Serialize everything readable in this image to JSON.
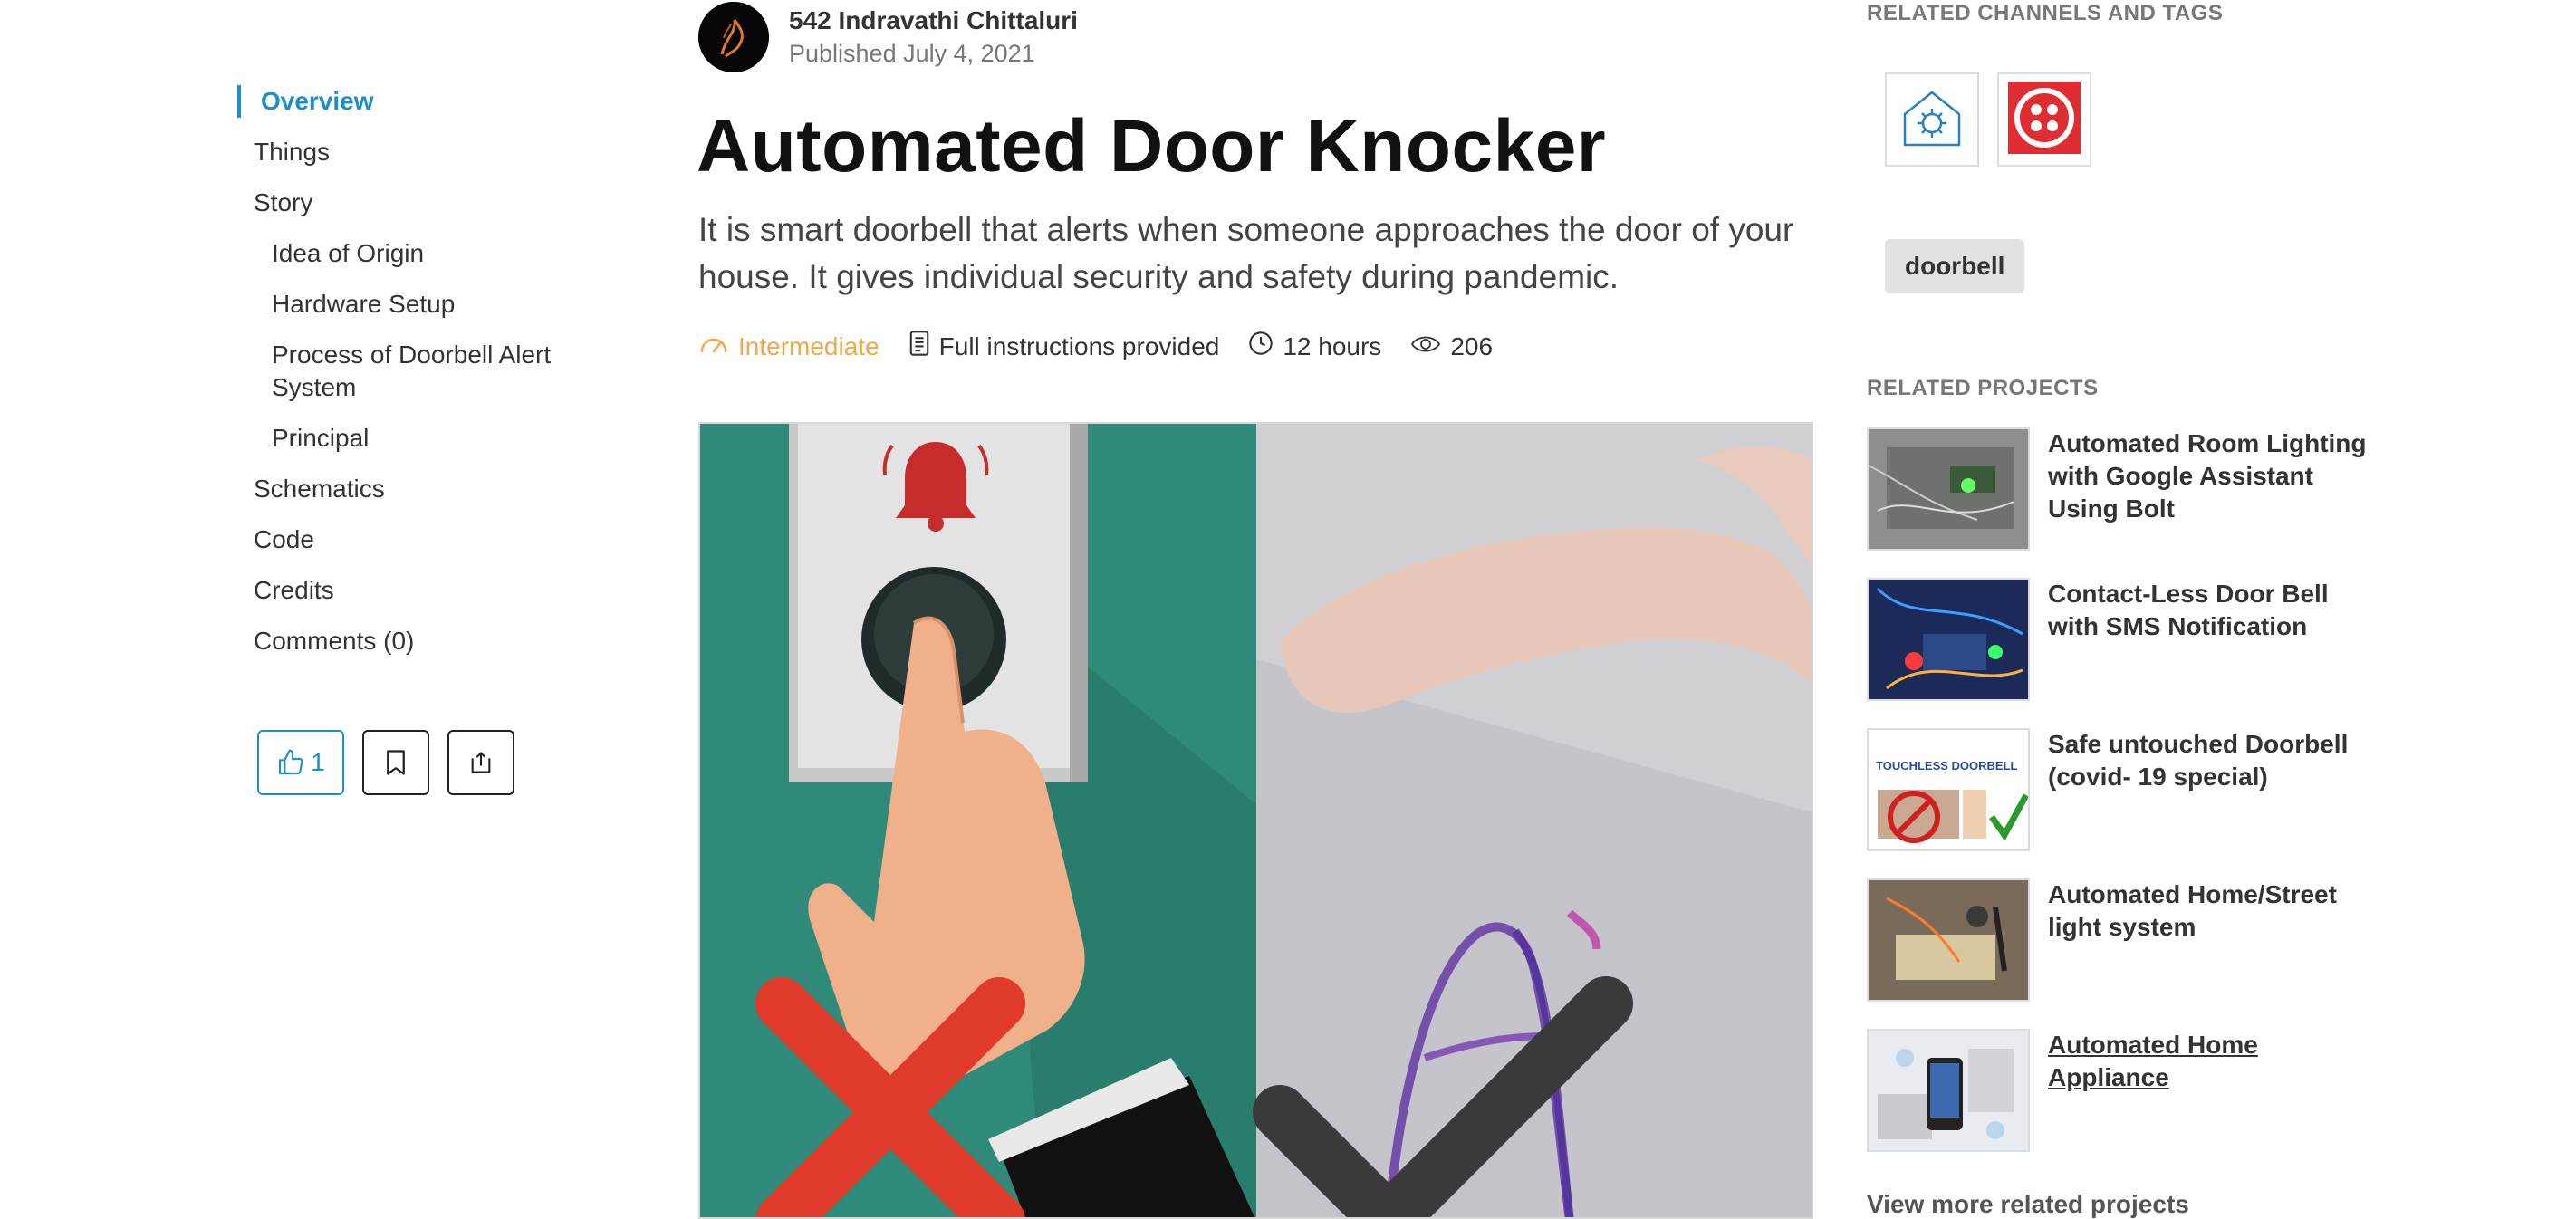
{
  "toc": {
    "items": [
      {
        "label": "Overview"
      },
      {
        "label": "Things"
      },
      {
        "label": "Story"
      },
      {
        "label": "Idea of Origin"
      },
      {
        "label": "Hardware Setup"
      },
      {
        "label": "Process of Doorbell Alert System"
      },
      {
        "label": "Principal"
      },
      {
        "label": "Schematics"
      },
      {
        "label": "Code"
      },
      {
        "label": "Credits"
      },
      {
        "label": "Comments (0)"
      }
    ]
  },
  "actions": {
    "like_count": "1"
  },
  "author": {
    "name": "542 Indravathi Chittaluri",
    "date": "Published July 4, 2021"
  },
  "project": {
    "title": "Automated Door Knocker",
    "description": "It is smart doorbell that alerts when someone approaches the door of your house. It gives individual security and safety during pandemic.",
    "level": "Intermediate",
    "instructions": "Full instructions provided",
    "duration": "12 hours",
    "views": "206"
  },
  "sidebar": {
    "channels_title": "RELATED CHANNELS AND TAGS",
    "tag": "doorbell",
    "related_title": "RELATED PROJECTS",
    "related": [
      {
        "name": "Automated Room Lighting with Google Assistant Using Bolt"
      },
      {
        "name": "Contact-Less Door Bell with SMS Notification"
      },
      {
        "name": "Safe untouched Doorbell (covid- 19 special)",
        "thumb_text": "TOUCHLESS DOORBELL"
      },
      {
        "name": "Automated Home/Street light system"
      },
      {
        "name": "Automated Home Appliance"
      }
    ],
    "view_more": "View more related projects"
  },
  "colors": {
    "accent": "#1e8ec9",
    "level": "#f0a848",
    "channel_red": "#e02c33"
  }
}
